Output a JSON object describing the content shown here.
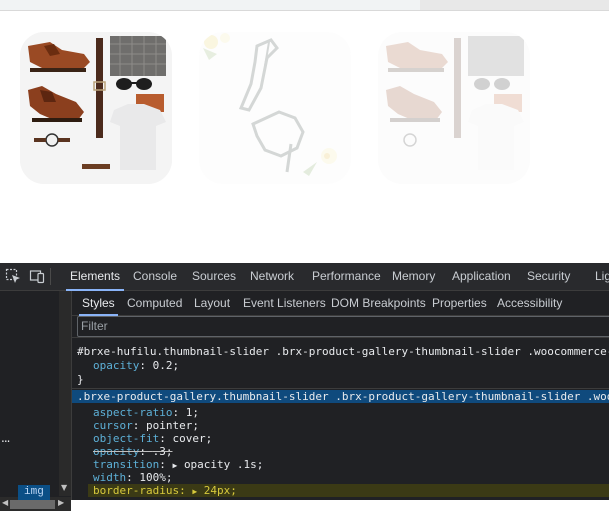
{
  "devtools": {
    "main_tabs": [
      "Elements",
      "Console",
      "Sources",
      "Network",
      "Performance",
      "Memory",
      "Application",
      "Security",
      "Lig"
    ],
    "active_main_tab": "Elements",
    "sub_tabs": [
      "Styles",
      "Computed",
      "Layout",
      "Event Listeners",
      "DOM Breakpoints",
      "Properties",
      "Accessibility"
    ],
    "active_sub_tab": "Styles",
    "filter_placeholder": "Filter",
    "dom_overflow": "...",
    "breadcrumb": "img",
    "rules": [
      {
        "selector": "#brxe-hufilu.thumbnail-slider .brx-product-gallery-thumbnail-slider .woocommerce-product-ga",
        "declarations": [
          {
            "name": "opacity",
            "value": "0.2;"
          }
        ],
        "close": "}"
      },
      {
        "selector": ".brxe-product-gallery.thumbnail-slider .brx-product-gallery-thumbnail-slider .woocommerce-p",
        "declarations": [
          {
            "name": "aspect-ratio",
            "value": "1;"
          },
          {
            "name": "cursor",
            "value": "pointer;"
          },
          {
            "name": "object-fit",
            "value": "cover;"
          },
          {
            "name": "opacity",
            "value": ".3;"
          },
          {
            "name": "transition",
            "value": "opacity .1s;"
          },
          {
            "name": "width",
            "value": "100%;"
          },
          {
            "name": "border-radius",
            "value": "24px;"
          }
        ]
      }
    ]
  },
  "preview": {
    "thumbnails": [
      {
        "subject": "shoes-and-accessories",
        "opacity": 1.0
      },
      {
        "subject": "high-heel-sandals",
        "opacity": 0.2
      },
      {
        "subject": "shoes-and-accessories",
        "opacity": 0.2
      }
    ]
  },
  "icon_names": [
    "inspect-element-icon",
    "device-toolbar-icon"
  ]
}
